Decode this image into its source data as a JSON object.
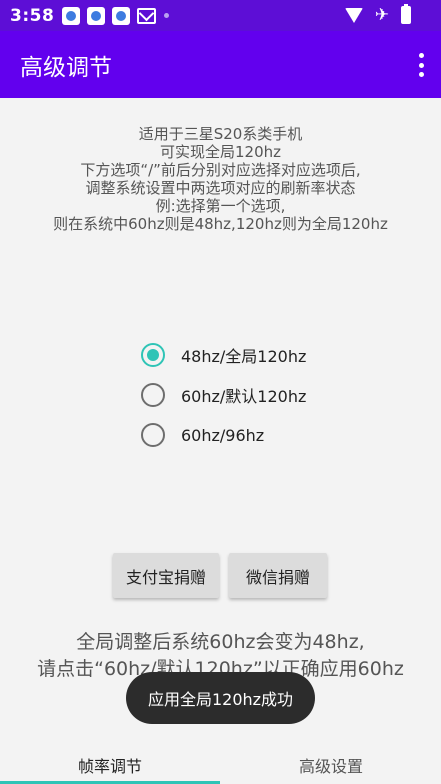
{
  "status_bar": {
    "time": "3:58",
    "icons": [
      "baidu-notification-icon",
      "baidu-notification-icon",
      "baidu-notification-icon",
      "mail-icon",
      "dot-icon",
      "wifi-icon",
      "airplane-icon",
      "battery-charging-icon"
    ]
  },
  "app_bar": {
    "title": "高级调节",
    "menu_icon": "more-vert-icon"
  },
  "description": {
    "lines": [
      "适用于三星S20系类手机",
      "可实现全局120hz",
      "下方选项“/”前后分别对应选择对应选项后,",
      "调整系统设置中两选项对应的刷新率状态",
      "例:选择第一个选项,",
      "则在系统中60hz则是48hz,120hz则为全局120hz"
    ]
  },
  "radio_options": [
    {
      "label": "48hz/全局120hz",
      "checked": true
    },
    {
      "label": "60hz/默认120hz",
      "checked": false
    },
    {
      "label": "60hz/96hz",
      "checked": false
    }
  ],
  "buttons": {
    "alipay": "支付宝捐赠",
    "wechat": "微信捐赠"
  },
  "notice": {
    "lines": [
      "全局调整后系统60hz会变为48hz,",
      "请点击“60hz/默认120hz”以正确应用60hz"
    ]
  },
  "toast": "应用全局120hz成功",
  "bottom_nav": {
    "tabs": [
      {
        "label": "帧率调节",
        "active": true
      },
      {
        "label": "高级设置",
        "active": false
      }
    ]
  },
  "colors": {
    "status_bar": "#5d0ed6",
    "app_bar": "#6200ee",
    "accent": "#2ec4b6",
    "background": "#f3f3f3"
  }
}
